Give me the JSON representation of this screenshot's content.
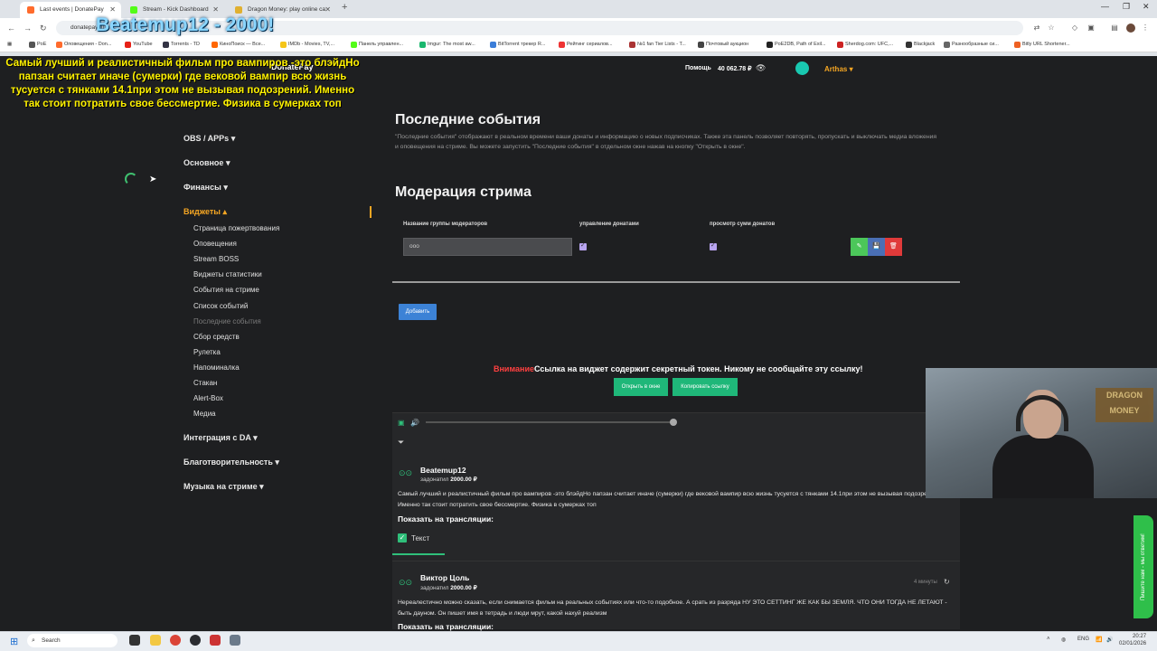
{
  "browser": {
    "tabs": [
      {
        "title": "Last events | DonatePay",
        "active": true,
        "color": "#ff6b2c"
      },
      {
        "title": "Stream - Kick Dashboard",
        "active": false,
        "color": "#53fc18"
      },
      {
        "title": "Dragon Money: play online ca",
        "active": false,
        "color": "#e0b030"
      }
    ],
    "url": "donatepay.ru",
    "bookmarks": [
      "PoE",
      "Оповещения - Don...",
      "YouTube",
      "Torrents - TD",
      "КиноПоиск — Все...",
      "IMDb - Movies, TV,...",
      "Панель управлен...",
      "Imgur: The most aw...",
      "BitTorrent трекер R...",
      "Рейтинг сериалов...",
      "№1 fan Tier Lists - T...",
      "Почтовый аукцион",
      "PoE2DB, Path of Exil...",
      "Sherdog.com: UFC,...",
      "Blackjack",
      "Разнообразные си...",
      "Bitly URL Shortener..."
    ]
  },
  "overlay": {
    "title": "Beatemup12 - 2000!",
    "message": "Самый лучший и реалистичный фильм про вампиров -это блэйдНо папзан считает иначе (сумерки) где вековой вампир всю жизнь тусуется с тянками 14.1при этом не вызывая подозрений. Именно так стоит потратить свое бессмертие. Физика в сумерках топ"
  },
  "header": {
    "logo": "DonatePay",
    "help": "Помощь",
    "balance": "40 062.78 ₽",
    "username": "Arthas"
  },
  "sidebar": {
    "sections": [
      {
        "label": "OBS / APPs",
        "arrow": "▾"
      },
      {
        "label": "Основное",
        "arrow": "▾"
      },
      {
        "label": "Финансы",
        "arrow": "▾"
      },
      {
        "label": "Виджеты",
        "arrow": "▴"
      },
      {
        "label": "Интеграция с DA",
        "arrow": "▾"
      },
      {
        "label": "Благотворительность",
        "arrow": "▾"
      },
      {
        "label": "Музыка на стриме",
        "arrow": "▾"
      }
    ],
    "widgets": [
      "Страница пожертвования",
      "Оповещения",
      "Stream BOSS",
      "Виджеты статистики",
      "События на стриме",
      "Список событий",
      "Последние события",
      "Сбор средств",
      "Рулетка",
      "Напоминалка",
      "Стакан",
      "Alert-Box",
      "Медиа"
    ]
  },
  "main": {
    "title": "Последние события",
    "description": "\"Последние события\" отображают в реальном времени ваши донаты и информацию о новых подписчиках. Также эта панель позволяет повторять, пропускать и выключать медиа вложения и оповещения на стриме. Вы можете запустить \"Последние события\" в отдельном окне нажав на кнопку \"Открыть в окне\".",
    "moderation_title": "Модерация стрима",
    "columns": [
      "Название группы модераторов",
      "управление донатами",
      "просмотр сумм донатов"
    ],
    "group_name": "ооо",
    "add_button": "Добавить",
    "warning_red": "Внимание",
    "warning_text": "Ссылка на виджет содержит секретный токен. Никому не сообщайте эту ссылку!",
    "open_window": "Открыть в окне",
    "copy_link": "Копировать ссылку"
  },
  "events": [
    {
      "name": "Beatemup12",
      "action": "задонатил",
      "amount": "2000.00 ₽",
      "text": "Самый лучший и реалистичный фильм про вампиров -это блэйдНо папзан считает иначе (сумерки) где вековой вампир всю жизнь тусуется с тянками 14.1при этом не вызывая подозрений. Именно так стоит потратить свое бессмертие. Физика в сумерках топ",
      "show_label": "Показать на трансляции:",
      "option": "Текст"
    },
    {
      "name": "Виктор Цоль",
      "action": "задонатил",
      "amount": "2000.00 ₽",
      "time": "4 минуты",
      "text": "Нереалестично можно сказать, если снимается фильм на реальных событиях или что-то подобное. А срать из разряда НУ ЭТО СЕТТИНГ ЖЕ КАК БЫ ЗЕМЛЯ. ЧТО ОНИ ТОГДА НЕ ЛЕТАЮТ - быть дауном. Он пишет имя в тетрадь и люди мрут, какой нахуй реализм",
      "show_label": "Показать на трансляции:"
    }
  ],
  "side_tab": "Пишите нам - мы ответим!",
  "taskbar": {
    "search": "Search",
    "lang": "ENG",
    "time": "20:27",
    "date": "02/01/2026"
  }
}
